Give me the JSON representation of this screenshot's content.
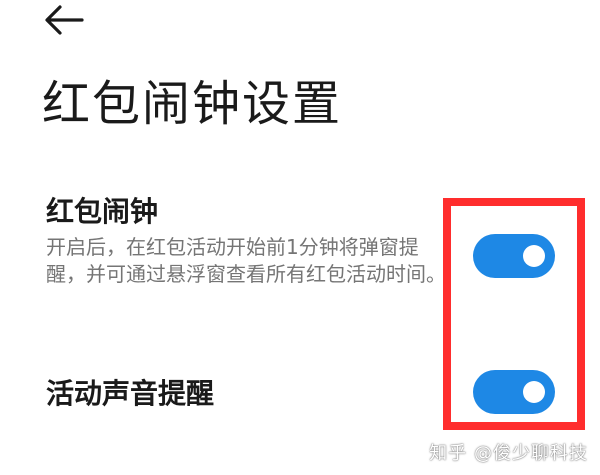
{
  "header": {
    "back_icon": "arrow-left-icon",
    "title": "红包闹钟设置"
  },
  "settings": [
    {
      "label": "红包闹钟",
      "description": "开启后，在红包活动开始前1分钟将弹窗提醒，并可通过悬浮窗查看所有红包活动时间。",
      "enabled": true
    },
    {
      "label": "活动声音提醒",
      "enabled": true
    }
  ],
  "watermark": "知乎 @俊少聊科技",
  "colors": {
    "toggle_on": "#1e88e5",
    "highlight": "#ff2d2d",
    "description_text": "#757575"
  }
}
